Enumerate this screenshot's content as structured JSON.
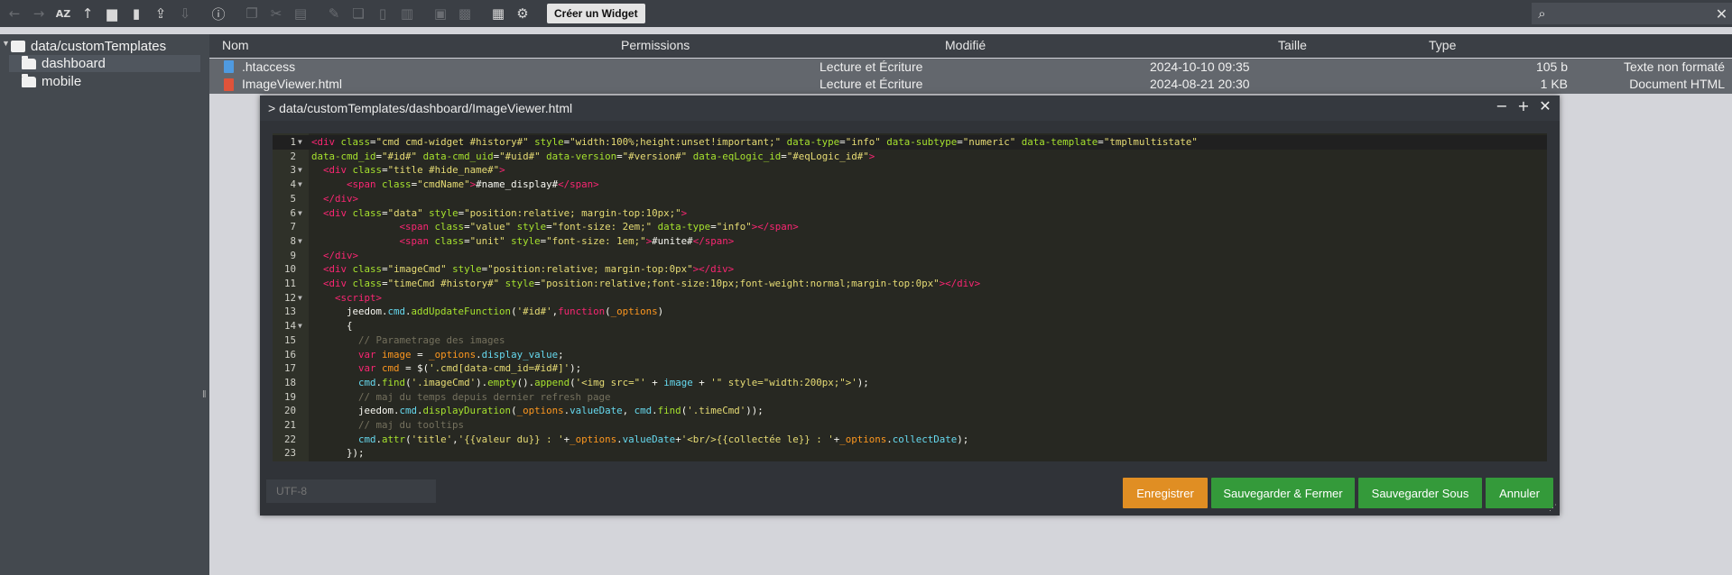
{
  "toolbar": {
    "icons": [
      "back-arrow-icon",
      "forward-arrow-icon",
      "sort-az-icon",
      "up-directory-icon",
      "new-folder-icon",
      "new-file-icon",
      "upload-icon",
      "download-icon",
      "info-icon",
      "copy-icon",
      "cut-icon",
      "paste-icon",
      "rename-icon",
      "duplicate-icon",
      "edit-icon",
      "delete-icon",
      "archive-icon",
      "extract-icon",
      "grid-view-icon",
      "settings-icon"
    ],
    "create_widget_label": "Créer un Widget",
    "search_value": ""
  },
  "tree": {
    "root": "data/customTemplates",
    "items": [
      "dashboard",
      "mobile"
    ],
    "selected": "dashboard"
  },
  "file_list": {
    "columns": [
      "Nom",
      "Permissions",
      "Modifié",
      "Taille",
      "Type"
    ],
    "rows": [
      {
        "name": ".htaccess",
        "permissions": "Lecture et Écriture",
        "modified": "2024-10-10 09:35",
        "size": "105 b",
        "type": "Texte non formaté"
      },
      {
        "name": "ImageViewer.html",
        "permissions": "Lecture et Écriture",
        "modified": "2024-08-21 20:30",
        "size": "1 KB",
        "type": "Document HTML"
      }
    ]
  },
  "modal": {
    "title": "> data/customTemplates/dashboard/ImageViewer.html",
    "encoding_placeholder": "UTF-8",
    "buttons": {
      "save": "Enregistrer",
      "save_close": "Sauvegarder & Fermer",
      "save_as": "Sauvegarder Sous",
      "cancel": "Annuler"
    },
    "colors": {
      "save": "#e08e23",
      "green": "#349a3a"
    }
  },
  "code": {
    "line_numbers": [
      "1",
      "2",
      "3",
      "4",
      "5",
      "6",
      "7",
      "8",
      "9",
      "10",
      "11",
      "12",
      "13",
      "14",
      "15",
      "16",
      "17",
      "18",
      "19",
      "20",
      "21",
      "22",
      "23"
    ],
    "foldable_lines": [
      1,
      3,
      4,
      6,
      8,
      12,
      14
    ]
  }
}
